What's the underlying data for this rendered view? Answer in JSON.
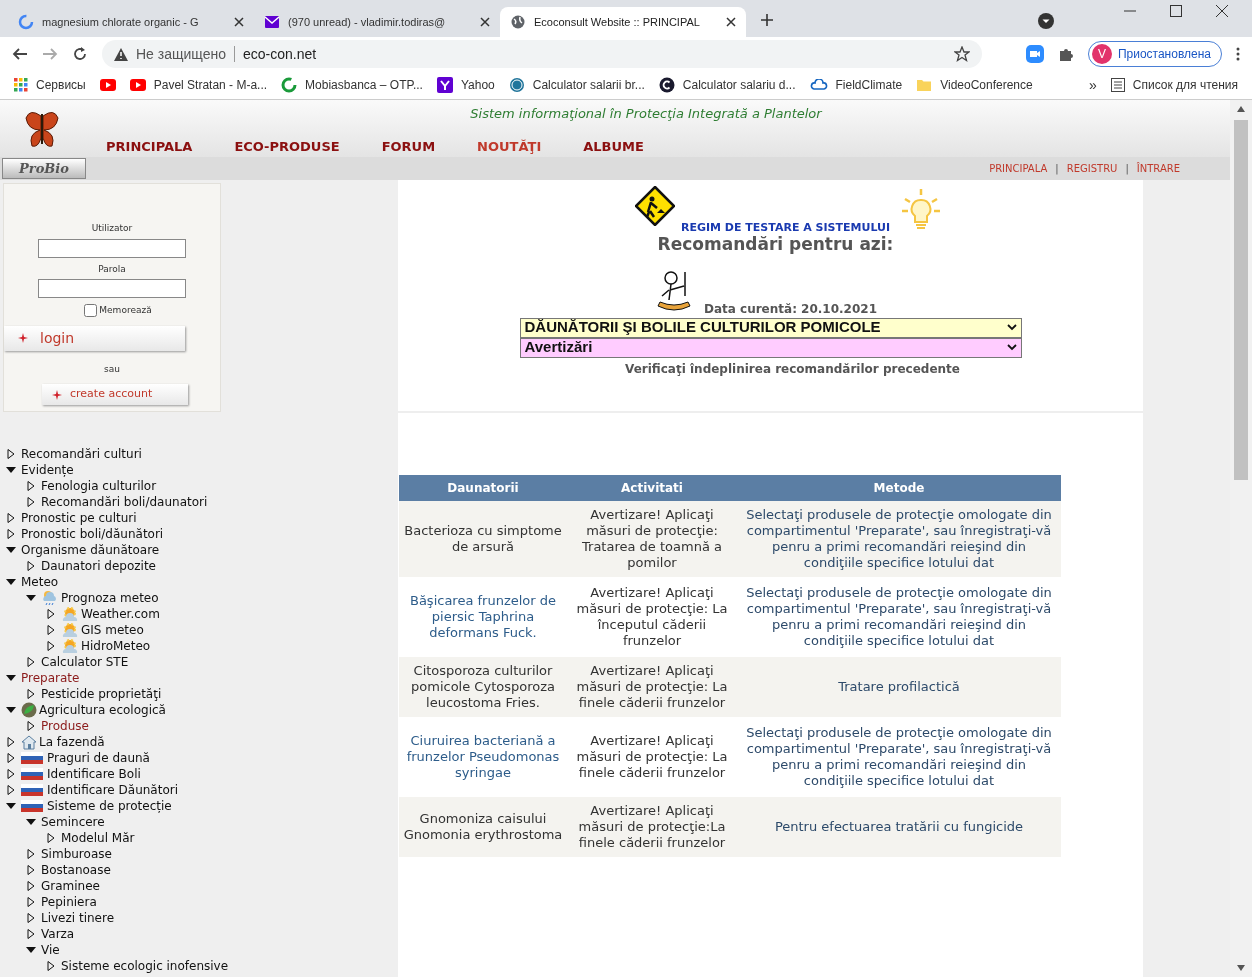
{
  "browser": {
    "tabs": [
      {
        "title": "magnesium chlorate organic - G",
        "selected": false
      },
      {
        "title": "(970 unread) - vladimir.todiras@",
        "selected": false
      },
      {
        "title": "Ecoconsult Website :: PRINCIPAL",
        "selected": true
      }
    ],
    "security": "Не защищено",
    "url": "eco-con.net",
    "profile": {
      "initial": "V",
      "label": "Приостановлена"
    },
    "bookmarks": [
      {
        "label": "Сервисы"
      },
      {
        "label": "Pavel Stratan - M-a..."
      },
      {
        "label": "Mobiasbanca – OTP..."
      },
      {
        "label": "Yahoo"
      },
      {
        "label": "Calculator salarii br..."
      },
      {
        "label": "Calculator salariu d..."
      },
      {
        "label": "FieldClimate"
      },
      {
        "label": "VideoConference"
      }
    ],
    "more": "»",
    "reading_list": "Список для чтения"
  },
  "site": {
    "tagline": "Sistem informaţional în Protecţia Integrată a Plantelor",
    "logo_text": "ProBio",
    "nav": [
      {
        "label": "PRINCIPALA",
        "selected": false
      },
      {
        "label": "ECO-PRODUSE",
        "selected": false
      },
      {
        "label": "FORUM",
        "selected": false
      },
      {
        "label": "NOUTĂŢI",
        "selected": true
      },
      {
        "label": "ALBUME",
        "selected": false
      }
    ],
    "top_links": [
      "PRINCIPALA",
      "REGISTRU",
      "ÎNTRARE"
    ],
    "separator": "|"
  },
  "login": {
    "user_label": "Utilizator",
    "password_label": "Parola",
    "remember": {
      "label": "Memorează",
      "checked": false
    },
    "login_button": "login",
    "or": "sau",
    "create_button": "create account"
  },
  "tree": [
    {
      "label": "Recomandări culturi",
      "expanded": false,
      "highlighted": false
    },
    {
      "label": "Evidențe",
      "expanded": true,
      "highlighted": false,
      "children": [
        {
          "label": "Fenologia culturilor",
          "expanded": false,
          "highlighted": false
        },
        {
          "label": "Recomandări boli/daunatori",
          "expanded": false,
          "highlighted": false
        }
      ]
    },
    {
      "label": "Pronostic pe culturi",
      "expanded": false,
      "highlighted": false
    },
    {
      "label": "Pronostic boli/dăunători",
      "expanded": false,
      "highlighted": false
    },
    {
      "label": "Organisme dăunătoare",
      "expanded": true,
      "highlighted": false,
      "children": [
        {
          "label": "Daunatori depozite",
          "expanded": false,
          "highlighted": false
        }
      ]
    },
    {
      "label": "Meteo",
      "expanded": true,
      "highlighted": false,
      "children": [
        {
          "label": "Prognoza meteo",
          "expanded": true,
          "highlighted": false,
          "children": [
            {
              "label": "Weather.com",
              "expanded": false,
              "highlighted": false
            },
            {
              "label": "GIS meteo",
              "expanded": false,
              "highlighted": false
            },
            {
              "label": "HidroMeteo",
              "expanded": false,
              "highlighted": false
            }
          ]
        },
        {
          "label": "Calculator STE",
          "expanded": false,
          "highlighted": false
        }
      ]
    },
    {
      "label": "Preparate",
      "expanded": true,
      "highlighted": true,
      "children": [
        {
          "label": "Pesticide proprietăţi",
          "expanded": false,
          "highlighted": false
        }
      ]
    },
    {
      "label": "Agricultura ecologică",
      "expanded": true,
      "highlighted": false,
      "children": [
        {
          "label": "Produse",
          "expanded": false,
          "highlighted": true
        }
      ]
    },
    {
      "label": "La fazendă",
      "expanded": false,
      "highlighted": false
    },
    {
      "label": "Praguri de daună",
      "expanded": false,
      "highlighted": false
    },
    {
      "label": "Identificare Boli",
      "expanded": false,
      "highlighted": false
    },
    {
      "label": "Identificare Dăunători",
      "expanded": false,
      "highlighted": false
    },
    {
      "label": "Sisteme de protecție",
      "expanded": true,
      "highlighted": false,
      "children": [
        {
          "label": "Semincere",
          "expanded": true,
          "highlighted": false,
          "children": [
            {
              "label": "Modelul Măr",
              "expanded": false,
              "highlighted": false
            }
          ]
        },
        {
          "label": "Simburoase",
          "expanded": false,
          "highlighted": false
        },
        {
          "label": "Bostanoase",
          "expanded": false,
          "highlighted": false
        },
        {
          "label": "Graminee",
          "expanded": false,
          "highlighted": false
        },
        {
          "label": "Pepiniera",
          "expanded": false,
          "highlighted": false
        },
        {
          "label": "Livezi tinere",
          "expanded": false,
          "highlighted": false
        },
        {
          "label": "Varza",
          "expanded": false,
          "highlighted": false
        },
        {
          "label": "Vie",
          "expanded": true,
          "highlighted": false,
          "children": [
            {
              "label": "Sisteme ecologic inofensive",
              "expanded": false,
              "highlighted": false
            }
          ]
        }
      ]
    }
  ],
  "main": {
    "test_mode": "REGIM DE TESTARE A SISTEMULUI",
    "heading": "Recomandări pentru azi:",
    "date": "Data curentă: 20.10.2021",
    "selects": [
      {
        "value": "DĂUNĂTORII ŞI BOLILE CULTURILOR POMICOLE",
        "color": "#ffffcc"
      },
      {
        "value": "Avertizări",
        "color": "#ffccff"
      }
    ],
    "verify": "Verificaţi îndeplinirea recomandărilor precedente"
  },
  "table": {
    "columns": [
      "Daunatorii",
      "Activitati",
      "Metode"
    ],
    "rows": [
      {
        "pest": "Bacterioza cu simptome de arsură",
        "link": false,
        "activity": "Avertizare! Aplicaţi măsuri de protecţie: Tratarea de toamnă a pomilor",
        "method": "Selectaţi produsele de protecţie omologate din compartimentul 'Preparate', sau înregistraţi-vă penru a primi recomandări reieşind din condiţiile specifice lotului dat"
      },
      {
        "pest": "Băşicarea frunzelor de piersic Taphrina deformans Fuck.",
        "link": true,
        "activity": "Avertizare! Aplicaţi măsuri de protecţie: La începutul căderii frunzelor",
        "method": "Selectaţi produsele de protecţie omologate din compartimentul 'Preparate', sau înregistraţi-vă penru a primi recomandări reieşind din condiţiile specifice lotului dat"
      },
      {
        "pest": "Citosporoza culturilor pomicole Cytosporoza leucostoma Fries.",
        "link": false,
        "activity": "Avertizare! Aplicaţi măsuri de protecţie: La finele căderii frunzelor",
        "method": "Tratare profilactică"
      },
      {
        "pest": "Ciuruirea bacteriană a frunzelor Pseudomonas syringae",
        "link": true,
        "activity": "Avertizare! Aplicaţi măsuri de protecţie: La finele căderii frunzelor",
        "method": "Selectaţi produsele de protecţie omologate din compartimentul 'Preparate', sau înregistraţi-vă penru a primi recomandări reieşind din condiţiile specifice lotului dat"
      },
      {
        "pest": "Gnomoniza caisului Gnomonia erythrostoma",
        "link": false,
        "activity": "Avertizare! Aplicaţi măsuri de protecţie:La finele căderii frunzelor",
        "method": "Pentru efectuarea tratării cu fungicide"
      }
    ]
  }
}
